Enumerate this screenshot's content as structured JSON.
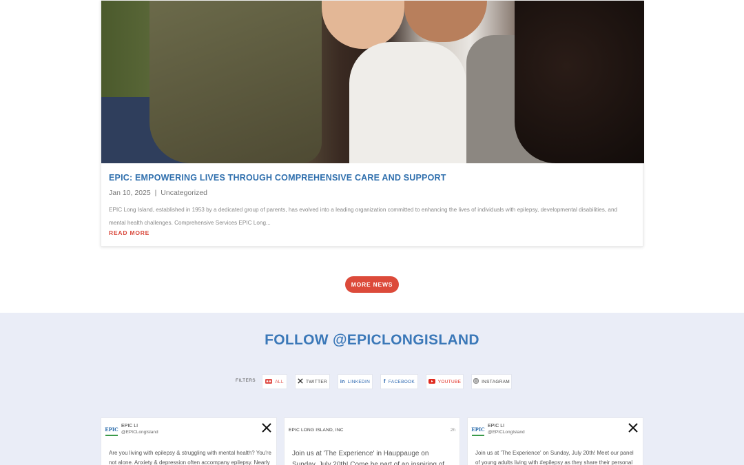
{
  "post": {
    "title": "EPIC: EMPOWERING LIVES THROUGH COMPREHENSIVE CARE AND SUPPORT",
    "date": "Jan 10, 2025",
    "separator": "|",
    "category": "Uncategorized",
    "excerpt": "EPIC Long Island, established in 1953 by a dedicated group of parents, has evolved into a leading organization committed to enhancing the lives of individuals with epilepsy, developmental disabilities, and mental health challenges. Comprehensive Services EPIC Long...",
    "read_more": "READ MORE"
  },
  "more_news": "MORE NEWS",
  "follow": {
    "title": "FOLLOW @EPICLONGISLAND",
    "filters_label": "FILTERS",
    "filters": [
      {
        "label": "ALL",
        "icon": "all-icon",
        "color": "#e0504a"
      },
      {
        "label": "TWITTER",
        "icon": "x-icon",
        "color": "#222222"
      },
      {
        "label": "LINKEDIN",
        "icon": "linkedin-icon",
        "color": "#2a66b0"
      },
      {
        "label": "FACEBOOK",
        "icon": "facebook-icon",
        "color": "#2a66b0"
      },
      {
        "label": "YOUTUBE",
        "icon": "youtube-icon",
        "color": "#e02b20"
      },
      {
        "label": "INSTAGRAM",
        "icon": "instagram-icon",
        "color": "#444444"
      }
    ]
  },
  "social_cards": [
    {
      "logo": "EPIC",
      "name": "EPIC LI",
      "handle": "@EPICLongIsland",
      "network_icon": "x-icon",
      "text": "Are you living with epilepsy & struggling with mental health? You're not alone. Anxiety & depression often accompany epilepsy. Nearly"
    },
    {
      "page_name": "EPIC LONG ISLAND, INC",
      "time": "2h",
      "text": "Join us at 'The Experience' in Hauppauge on Sunday, July 20th! Come be part of an inspiring of"
    },
    {
      "logo": "EPIC",
      "name": "EPIC LI",
      "handle": "@EPICLongIsland",
      "network_icon": "x-icon",
      "text": "Join us at 'The Experience' on Sunday, July 20th! Meet our panel of young adults living with #epilepsy as they share their personal jour-"
    }
  ],
  "colors": {
    "accent_blue": "#2f6fad",
    "accent_red": "#dc4a3a",
    "section_bg": "#eaedf7"
  }
}
